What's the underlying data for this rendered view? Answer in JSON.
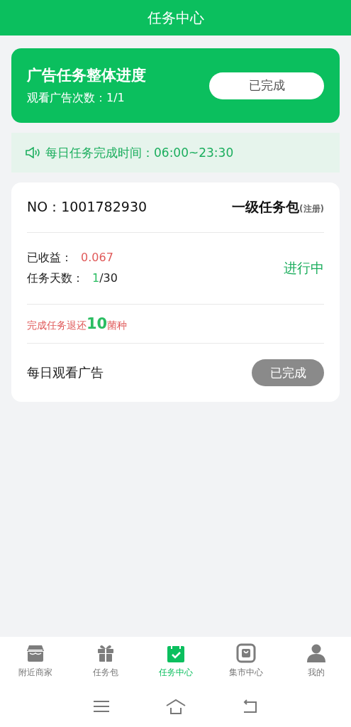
{
  "header": {
    "title": "任务中心"
  },
  "progress_card": {
    "title": "广告任务整体进度",
    "count_label": "观看广告次数：1/1",
    "button": "已完成"
  },
  "notice": {
    "text": "每日任务完成时间：06:00~23:30"
  },
  "task_card": {
    "number": "NO：1001782930",
    "package_name": "一级任务包",
    "package_tag": "(注册)",
    "earnings_label": "已收益：",
    "earnings_value": "0.067",
    "days_label": "任务天数：",
    "days_done": "1",
    "days_total": "/30",
    "status": "进行中",
    "refund_prefix": "完成任务退还",
    "refund_amount": "10",
    "refund_suffix": "菌种",
    "daily_label": "每日观看广告",
    "daily_button": "已完成",
    "daily_done": true
  },
  "tabs": [
    {
      "label": "附近商家",
      "selected": false
    },
    {
      "label": "任务包",
      "selected": false
    },
    {
      "label": "任务中心",
      "selected": true
    },
    {
      "label": "集市中心",
      "selected": false
    },
    {
      "label": "我的",
      "selected": false
    }
  ]
}
